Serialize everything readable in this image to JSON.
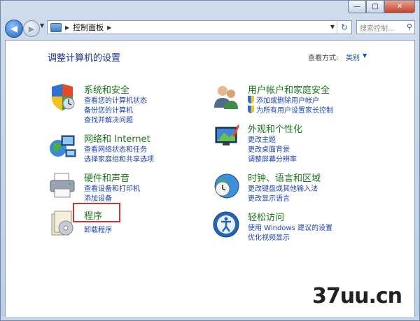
{
  "window": {
    "buttons": {
      "minimize": "—",
      "maximize": "□",
      "close": "✕"
    }
  },
  "toolbar": {
    "back": "◀",
    "forward": "▶",
    "breadcrumb_sep": "▶",
    "breadcrumb": "控制面板",
    "breadcrumb_tail": "▶",
    "dropdown": "▼",
    "refresh": "↻",
    "search_placeholder": "搜索控制...",
    "search_icon": "⚲"
  },
  "main": {
    "title": "调整计算机的设置",
    "view_by_label": "查看方式:",
    "view_by_value": "类别",
    "view_by_arrow": "▼"
  },
  "categories": [
    {
      "title": "系统和安全",
      "links": [
        "查看您的计算机状态",
        "备份您的计算机",
        "查找并解决问题"
      ],
      "icon": "shield-icon"
    },
    {
      "title": "网络和 Internet",
      "links": [
        "查看网络状态和任务",
        "选择家庭组和共享选项"
      ],
      "icon": "network-icon"
    },
    {
      "title": "硬件和声音",
      "links": [
        "查看设备和打印机",
        "添加设备"
      ],
      "icon": "printer-icon"
    },
    {
      "title": "程序",
      "links": [
        "卸载程序"
      ],
      "icon": "programs-icon"
    },
    {
      "title": "用户帐户和家庭安全",
      "links": [
        "添加或删除用户帐户",
        "为所有用户设置家长控制"
      ],
      "icon": "users-icon"
    },
    {
      "title": "外观和个性化",
      "links": [
        "更改主题",
        "更改桌面背景",
        "调整屏幕分辨率"
      ],
      "icon": "appearance-icon"
    },
    {
      "title": "时钟、语言和区域",
      "links": [
        "更改键盘或其他输入法",
        "更改显示语言"
      ],
      "icon": "clock-globe-icon"
    },
    {
      "title": "轻松访问",
      "links": [
        "使用 Windows 建议的设置",
        "优化视频显示"
      ],
      "icon": "accessibility-icon"
    }
  ],
  "watermark": "37uu.cn"
}
